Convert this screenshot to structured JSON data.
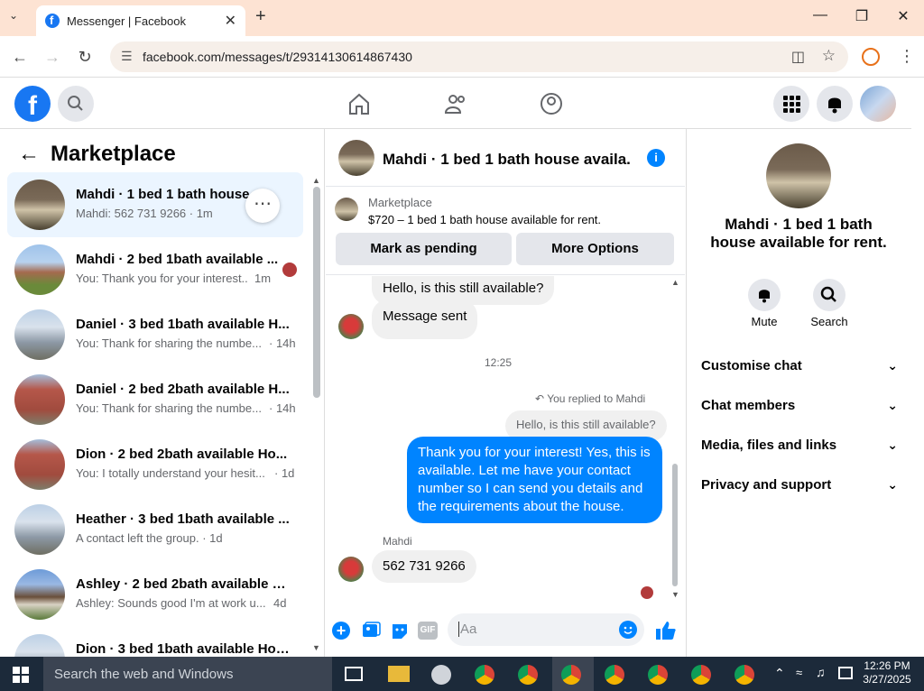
{
  "browser": {
    "tab_title": "Messenger | Facebook",
    "url": "facebook.com/messages/t/29314130614867430",
    "new_tab": "+",
    "tab_close": "✕"
  },
  "sidebar": {
    "title": "Marketplace",
    "conversations": [
      {
        "name": "Mahdi · 1 bed 1 bath house av...",
        "preview": "Mahdi: 562 731 9266 · 1m",
        "time": ""
      },
      {
        "name": "Mahdi · 2 bed 1bath available ...",
        "preview": "You: Thank you for your interest...",
        "time": "1m"
      },
      {
        "name": "Daniel · 3 bed 1bath available H...",
        "preview": "You: Thank for sharing the numbe...",
        "time": "· 14h"
      },
      {
        "name": "Daniel · 2 bed 2bath available H...",
        "preview": "You: Thank for sharing the numbe...",
        "time": "· 14h"
      },
      {
        "name": "Dion · 2 bed 2bath available Ho...",
        "preview": "You: I totally understand your hesit...",
        "time": "· 1d"
      },
      {
        "name": "Heather · 3 bed 1bath available ...",
        "preview": "A contact left the group. · 1d",
        "time": ""
      },
      {
        "name": "Ashley · 2 bed 2bath available H...",
        "preview": "Ashley: Sounds good I'm at work u...",
        "time": "4d"
      },
      {
        "name": "Dion · 3 bed 1bath available Hou...",
        "preview": "",
        "time": ""
      }
    ]
  },
  "chat": {
    "header_title": "Mahdi · 1 bed 1 bath house availa...",
    "listing_label": "Marketplace",
    "listing_text": "$720 – 1 bed 1 bath house available for rent.",
    "mark_pending": "Mark as pending",
    "more_options": "More Options",
    "msg1": "Hello, is this still available?",
    "msg2": "Message sent",
    "timestamp": "12:25",
    "replied_label": "You replied to Mahdi",
    "quoted": "Hello, is this still available?",
    "out_msg": "Thank you for your interest! Yes, this is available. Let me have your contact number so I can send you details and the requirements about the house.",
    "sender_name": "Mahdi",
    "last_msg": "562 731 9266",
    "input_placeholder": "Aa",
    "gif_label": "GIF"
  },
  "details": {
    "title": "Mahdi · 1 bed 1 bath house available for rent.",
    "mute": "Mute",
    "search": "Search",
    "sections": [
      "Customise chat",
      "Chat members",
      "Media, files and links",
      "Privacy and support"
    ]
  },
  "taskbar": {
    "search_placeholder": "Search the web and Windows",
    "time": "12:26 PM",
    "date": "3/27/2025"
  },
  "colors": {
    "accent": "#0084ff",
    "fb_blue": "#1877f2"
  }
}
